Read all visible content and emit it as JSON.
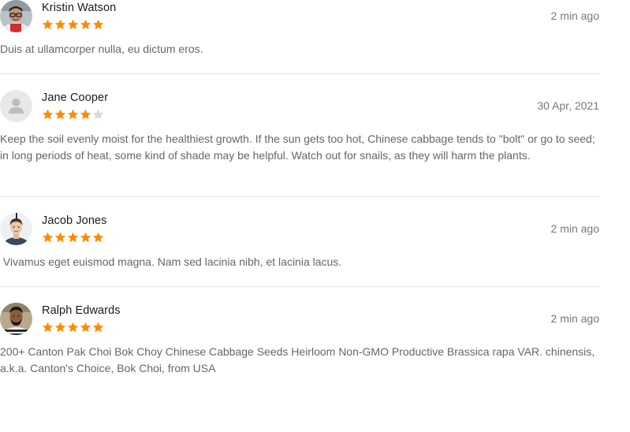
{
  "colors": {
    "star_filled": "#ff8a00",
    "star_empty": "#d8d8d8",
    "divider": "#e6e6e6",
    "name": "#1a1a1a",
    "meta": "#777777",
    "body_text": "#666666"
  },
  "reviews": [
    {
      "author": "Kristin Watson",
      "avatar": "avatar-photo-man-glasses",
      "rating": 5,
      "time": "2 min ago",
      "text": "Duis at ullamcorper nulla, eu dictum eros."
    },
    {
      "author": "Jane Cooper",
      "avatar": "avatar-placeholder-icon",
      "rating": 4,
      "time": "30 Apr, 2021",
      "text": "Keep the soil evenly moist for the healthiest growth. If the sun gets too hot, Chinese cabbage tends to \"bolt\" or go to seed; in long periods of heat, some kind of shade may be helpful. Watch out for snails, as they will harm the plants."
    },
    {
      "author": "Jacob Jones",
      "avatar": "avatar-photo-woman",
      "rating": 5,
      "time": "2 min ago",
      "text": " Vivamus eget euismod magna. Nam sed lacinia nibh, et lacinia lacus."
    },
    {
      "author": "Ralph Edwards",
      "avatar": "avatar-photo-man-beard",
      "rating": 5,
      "time": "2 min ago",
      "text": "200+ Canton Pak Choi Bok Choy Chinese Cabbage Seeds Heirloom Non-GMO Productive Brassica rapa VAR. chinensis, a.k.a. Canton's Choice, Bok Choi, from USA"
    }
  ]
}
